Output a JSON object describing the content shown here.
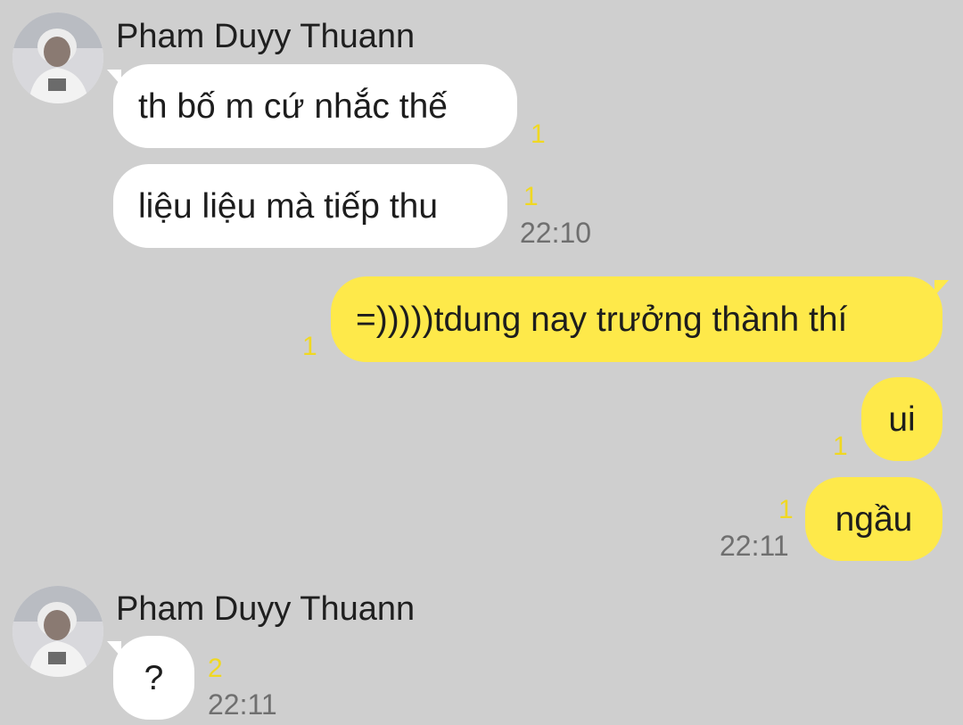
{
  "colors": {
    "background": "#cfcfcf",
    "incoming_bubble": "#ffffff",
    "outgoing_bubble": "#fee94a",
    "unread_count": "#f0d822",
    "timestamp": "#6f6f6f"
  },
  "groups": [
    {
      "sender": "Pham Duyy Thuann",
      "messages": [
        {
          "text": "th bố m cứ nhắc thế",
          "unread": "1"
        },
        {
          "text": "liệu liệu mà tiếp thu",
          "unread": "1",
          "time": "22:10"
        }
      ]
    },
    {
      "sender": "me",
      "messages": [
        {
          "text": "=)))))tdung nay trưởng thành thí",
          "unread": "1"
        },
        {
          "text": "ui",
          "unread": "1"
        },
        {
          "text": "ngầu",
          "unread": "1",
          "time": "22:11"
        }
      ]
    },
    {
      "sender": "Pham Duyy Thuann",
      "messages": [
        {
          "text": "?",
          "unread": "2",
          "time": "22:11"
        }
      ]
    }
  ]
}
